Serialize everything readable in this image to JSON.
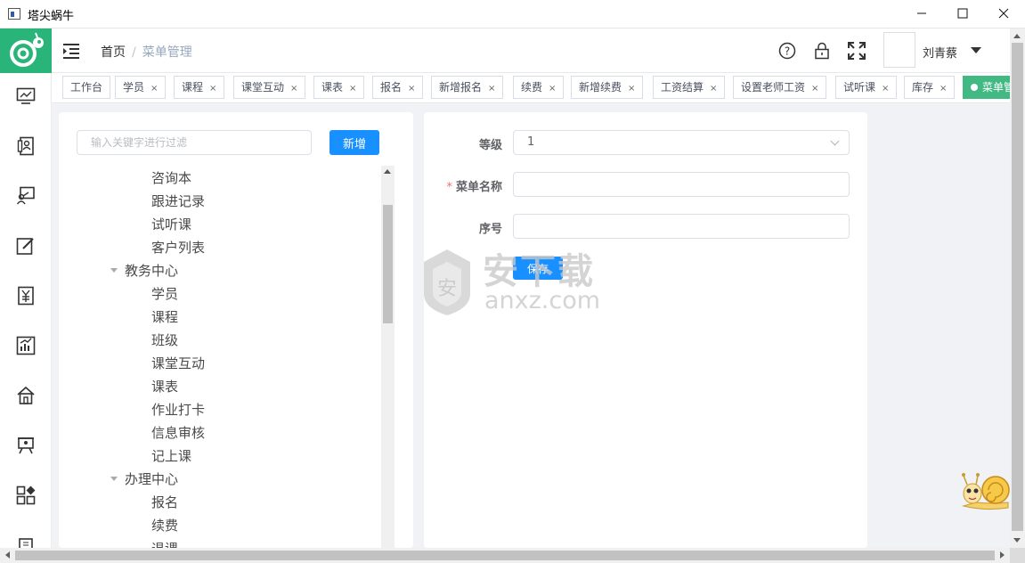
{
  "window": {
    "title": "塔尖蜗牛"
  },
  "header": {
    "breadcrumb": {
      "home": "首页",
      "separator": "/",
      "current": "菜单管理"
    },
    "user_name": "刘青蔡"
  },
  "tags": [
    {
      "label": "工作台",
      "closable": false,
      "active": false
    },
    {
      "label": "学员",
      "closable": true,
      "active": false
    },
    {
      "label": "课程",
      "closable": true,
      "active": false
    },
    {
      "label": "课堂互动",
      "closable": true,
      "active": false
    },
    {
      "label": "课表",
      "closable": true,
      "active": false
    },
    {
      "label": "报名",
      "closable": true,
      "active": false
    },
    {
      "label": "新增报名",
      "closable": true,
      "active": false
    },
    {
      "label": "续费",
      "closable": true,
      "active": false
    },
    {
      "label": "新增续费",
      "closable": true,
      "active": false
    },
    {
      "label": "工资结算",
      "closable": true,
      "active": false
    },
    {
      "label": "设置老师工资",
      "closable": true,
      "active": false
    },
    {
      "label": "试听课",
      "closable": true,
      "active": false
    },
    {
      "label": "库存",
      "closable": true,
      "active": false
    },
    {
      "label": "菜单管",
      "closable": false,
      "active": true
    }
  ],
  "left_panel": {
    "filter_placeholder": "输入关键字进行过滤",
    "add_button": "新增",
    "tree": [
      {
        "label": "咨询本",
        "level": 2,
        "expandable": false
      },
      {
        "label": "跟进记录",
        "level": 2,
        "expandable": false
      },
      {
        "label": "试听课",
        "level": 2,
        "expandable": false
      },
      {
        "label": "客户列表",
        "level": 2,
        "expandable": false
      },
      {
        "label": "教务中心",
        "level": 1,
        "expandable": true
      },
      {
        "label": "学员",
        "level": 2,
        "expandable": false
      },
      {
        "label": "课程",
        "level": 2,
        "expandable": false
      },
      {
        "label": "班级",
        "level": 2,
        "expandable": false
      },
      {
        "label": "课堂互动",
        "level": 2,
        "expandable": false
      },
      {
        "label": "课表",
        "level": 2,
        "expandable": false
      },
      {
        "label": "作业打卡",
        "level": 2,
        "expandable": false
      },
      {
        "label": "信息审核",
        "level": 2,
        "expandable": false
      },
      {
        "label": "记上课",
        "level": 2,
        "expandable": false
      },
      {
        "label": "办理中心",
        "level": 1,
        "expandable": true
      },
      {
        "label": "报名",
        "level": 2,
        "expandable": false
      },
      {
        "label": "续费",
        "level": 2,
        "expandable": false
      },
      {
        "label": "退课",
        "level": 2,
        "expandable": false
      }
    ]
  },
  "form": {
    "level_label": "等级",
    "level_value": "1",
    "name_label": "菜单名称",
    "name_required": "*",
    "name_value": "",
    "order_label": "序号",
    "order_value": "",
    "save_button": "保存"
  },
  "watermark": {
    "text_cn": "安下载",
    "text_en": "anxz.com"
  },
  "colors": {
    "brand": "#29b57a",
    "primary": "#1890ff",
    "active_tag": "#42b983"
  },
  "sidebar_icons": [
    "monitor-icon",
    "contacts-icon",
    "classroom-icon",
    "edit-icon",
    "finance-icon",
    "chart-icon",
    "home-icon",
    "teacher-icon",
    "apps-icon",
    "building-icon"
  ]
}
